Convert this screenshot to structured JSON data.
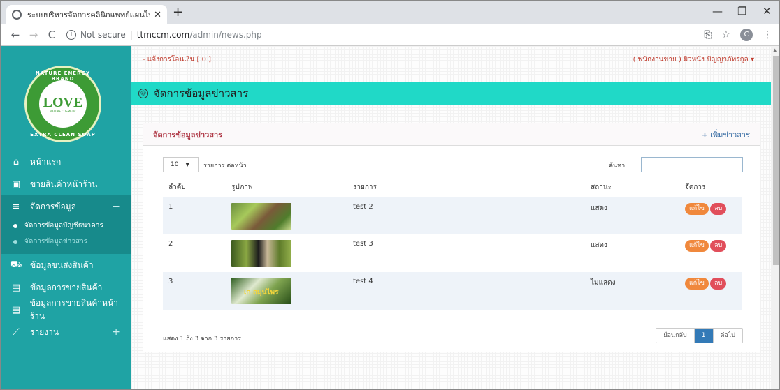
{
  "browser": {
    "tab_title": "ระบบบริหารจัดการคลินิกแพทย์แผนไทย",
    "tab_close": "✕",
    "new_tab": "+",
    "minimize": "—",
    "restore": "❐",
    "close": "✕",
    "security": "Not secure",
    "url_host": "ttmccm.com",
    "url_path": "/admin/news.php",
    "profile_initial": "C"
  },
  "sidebar": {
    "logo_text": "LOVE",
    "logo_sub": "NATURE COSMETIC",
    "logo_ring_top": "NATURE ENERGY BRAND",
    "logo_ring_bottom": "EXTRA CLEAN SOAP",
    "items": [
      {
        "label": "หน้าแรก",
        "icon": "home-icon"
      },
      {
        "label": "ขายสินค้าหน้าร้าน",
        "icon": "cash-icon"
      },
      {
        "label": "จัดการข้อมูล",
        "icon": "list-icon",
        "toggle": "−"
      },
      {
        "label": "ข้อมูลขนส่งสินค้า",
        "icon": "truck-icon"
      },
      {
        "label": "ข้อมูลการขายสินค้า",
        "icon": "file-icon"
      },
      {
        "label": "ข้อมูลการขายสินค้าหน้าร้าน",
        "icon": "file-icon"
      },
      {
        "label": "รายงาน",
        "icon": "chart-icon",
        "toggle": "+"
      }
    ],
    "subitems": [
      {
        "label": "จัดการข้อมูลบัญชีธนาคาร"
      },
      {
        "label": "จัดการข้อมูลข่าวสาร"
      }
    ]
  },
  "header": {
    "transfer_notice": "- แจ้งการโอนเงิน [ 0 ]",
    "user": "( พนักงานขาย ) ผิวหนัง ปัญญาภัทรกุล ▾"
  },
  "page": {
    "title": "จัดการข้อมูลข่าวสาร",
    "panel_title": "จัดการข้อมูลข่าวสาร",
    "add_label": "เพิ่มข่าวสาร"
  },
  "table": {
    "length_value": "10",
    "length_label": "รายการ ต่อหน้า",
    "search_label": "ค้นหา :",
    "search_value": "",
    "columns": [
      "ลำดับ",
      "รูปภาพ",
      "รายการ",
      "สถานะ",
      "จัดการ"
    ],
    "rows": [
      {
        "no": "1",
        "title": "test 2",
        "status": "แสดง",
        "image_caption": "",
        "edit": "แก้ไข",
        "delete": "ลบ"
      },
      {
        "no": "2",
        "title": "test 3",
        "status": "แสดง",
        "image_caption": "",
        "edit": "แก้ไข",
        "delete": "ลบ"
      },
      {
        "no": "3",
        "title": "test 4",
        "status": "ไม่แสดง",
        "image_caption": "เก สมุนไพร",
        "edit": "แก้ไข",
        "delete": "ลบ"
      }
    ],
    "info": "แสดง 1 ถึง 3 จาก 3 รายการ",
    "pager": {
      "prev": "ย้อนกลับ",
      "current": "1",
      "next": "ต่อไป"
    }
  },
  "colors": {
    "sidebar": "#1fa3a4",
    "page_header": "#20d9c7",
    "panel_title": "#b03a48",
    "edit_button": "#f0883c",
    "delete_button": "#e14e5b",
    "pager_active": "#337ab7"
  }
}
